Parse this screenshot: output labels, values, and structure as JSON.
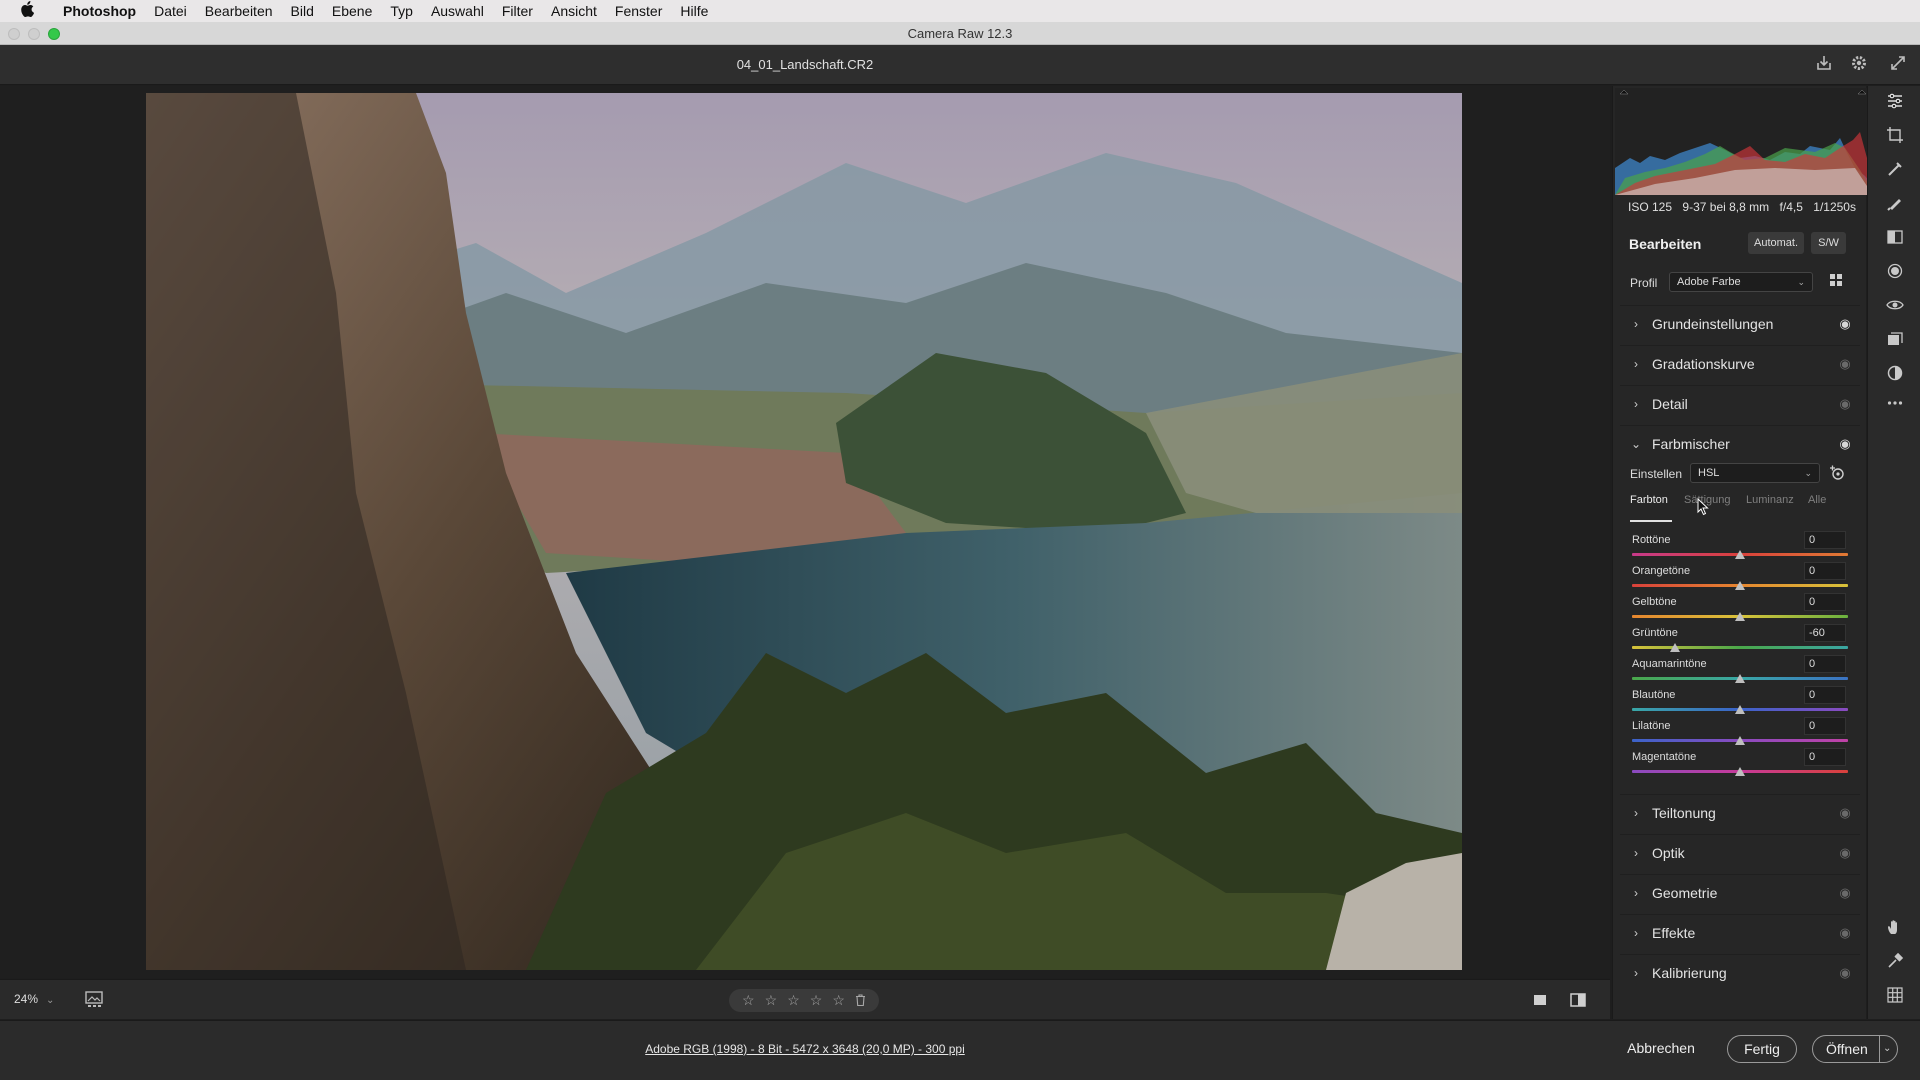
{
  "menubar": {
    "apple": "",
    "app": "Photoshop",
    "items": [
      "Datei",
      "Bearbeiten",
      "Bild",
      "Ebene",
      "Typ",
      "Auswahl",
      "Filter",
      "Ansicht",
      "Fenster",
      "Hilfe"
    ]
  },
  "window": {
    "title": "Camera Raw 12.3"
  },
  "file": {
    "name": "04_01_Landschaft.CR2"
  },
  "camera_info": {
    "iso": "ISO 125",
    "lens": "9-37 bei 8,8 mm",
    "aperture": "f/4,5",
    "shutter": "1/1250s"
  },
  "edit": {
    "heading": "Bearbeiten",
    "auto_label": "Automat.",
    "bw_label": "S/W",
    "profile_label": "Profil",
    "profile_value": "Adobe Farbe"
  },
  "sections_top": [
    {
      "label": "Grundeinstellungen",
      "eye_on": true
    },
    {
      "label": "Gradationskurve",
      "eye_on": false
    },
    {
      "label": "Detail",
      "eye_on": false
    }
  ],
  "farbmischer": {
    "label": "Farbmischer",
    "einstellen_label": "Einstellen",
    "einstellen_value": "HSL",
    "tabs": [
      "Farbton",
      "Sättigung",
      "Luminanz",
      "Alle"
    ],
    "active_tab": "Farbton",
    "rows": [
      {
        "name": "Rottöne",
        "value": "0"
      },
      {
        "name": "Orangetöne",
        "value": "0"
      },
      {
        "name": "Gelbtöne",
        "value": "0"
      },
      {
        "name": "Grüntöne",
        "value": "-60"
      },
      {
        "name": "Aquamarintöne",
        "value": "0"
      },
      {
        "name": "Blautöne",
        "value": "0"
      },
      {
        "name": "Lilatöne",
        "value": "0"
      },
      {
        "name": "Magentatöne",
        "value": "0"
      }
    ]
  },
  "sections_bottom": [
    {
      "label": "Teiltonung"
    },
    {
      "label": "Optik"
    },
    {
      "label": "Geometrie"
    },
    {
      "label": "Effekte"
    },
    {
      "label": "Kalibrierung"
    }
  ],
  "toolbar": {
    "zoom": "24%",
    "rating_stars": 5
  },
  "footer": {
    "info": "Adobe RGB (1998) - 8 Bit - 5472 x 3648 (20,0 MP) - 300 ppi",
    "cancel": "Abbrechen",
    "done": "Fertig",
    "open": "Öffnen"
  },
  "colors": {
    "menubar_bg": "#e9e7e8",
    "panel_bg": "#262626",
    "canvas_bg": "#1f1f1f"
  }
}
